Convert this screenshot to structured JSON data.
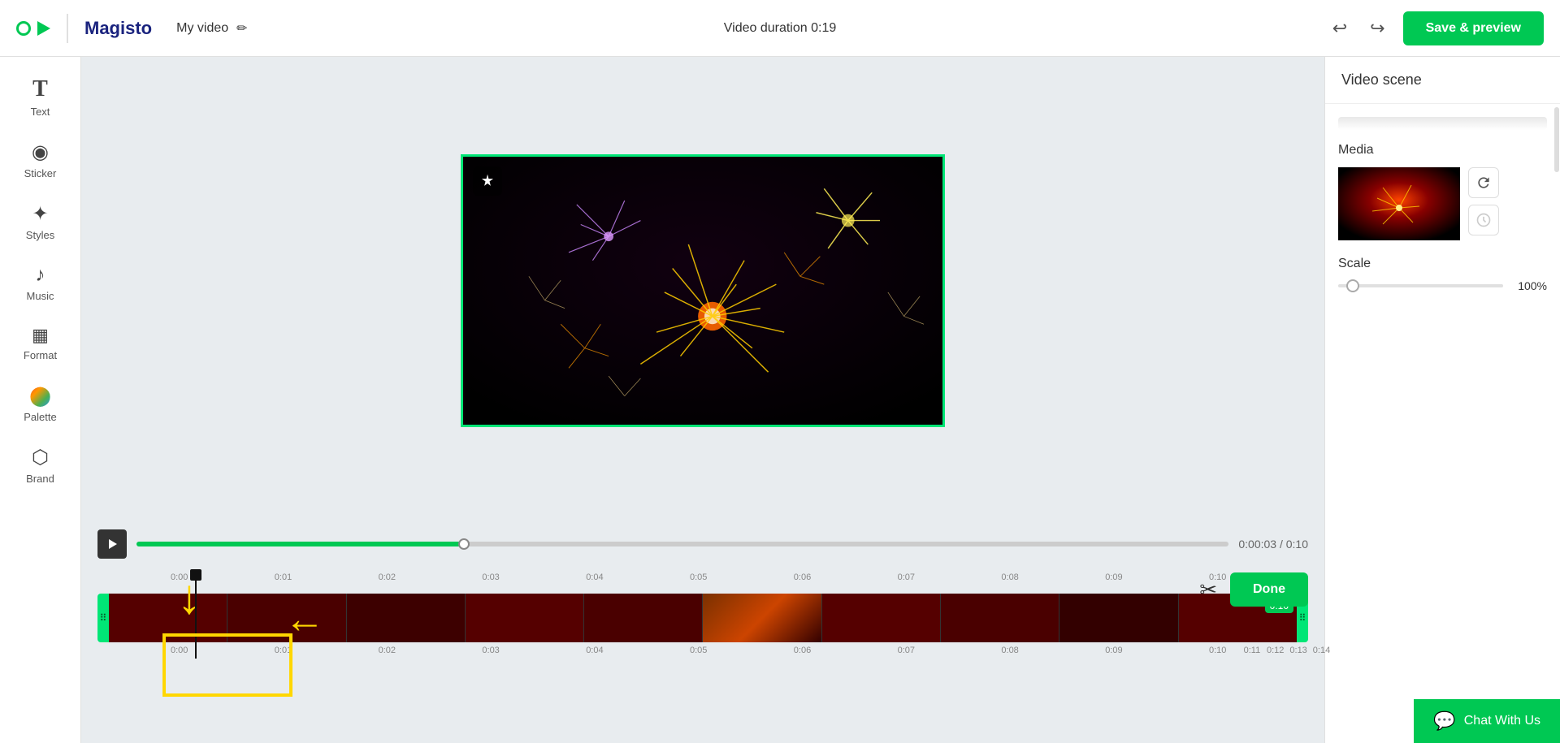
{
  "app": {
    "name": "Magisto"
  },
  "header": {
    "title": "My video",
    "duration_label": "Video duration 0:19",
    "save_preview_label": "Save & preview",
    "undo_icon": "↩",
    "redo_icon": "↪",
    "edit_icon": "✏"
  },
  "sidebar": {
    "items": [
      {
        "id": "text",
        "label": "Text",
        "icon": "T"
      },
      {
        "id": "sticker",
        "label": "Sticker",
        "icon": "◯"
      },
      {
        "id": "styles",
        "label": "Styles",
        "icon": "✦"
      },
      {
        "id": "music",
        "label": "Music",
        "icon": "♪"
      },
      {
        "id": "format",
        "label": "Format",
        "icon": "▦"
      },
      {
        "id": "palette",
        "label": "Palette",
        "icon": "🎨"
      },
      {
        "id": "brand",
        "label": "Brand",
        "icon": "⬡"
      }
    ]
  },
  "video_panel": {
    "title": "Video scene",
    "media_label": "Media",
    "scale_label": "Scale",
    "scale_value": "100%",
    "refresh_icon": "↻",
    "clock_icon": "🕐"
  },
  "timeline": {
    "current_time": "0:00:03",
    "total_time": "0:10",
    "time_badge": "0:10",
    "ruler_ticks": [
      "0:00",
      "0:01",
      "0:02",
      "0:03",
      "0:04",
      "0:05",
      "0:06",
      "0:07",
      "0:08",
      "0:09",
      "0:10",
      "0:11",
      "0:12",
      "0:13",
      "0:14",
      "0:18"
    ],
    "scissors_icon": "✂",
    "done_label": "Done"
  },
  "chat_widget": {
    "label": "Chat With Us",
    "icon": "💬"
  }
}
